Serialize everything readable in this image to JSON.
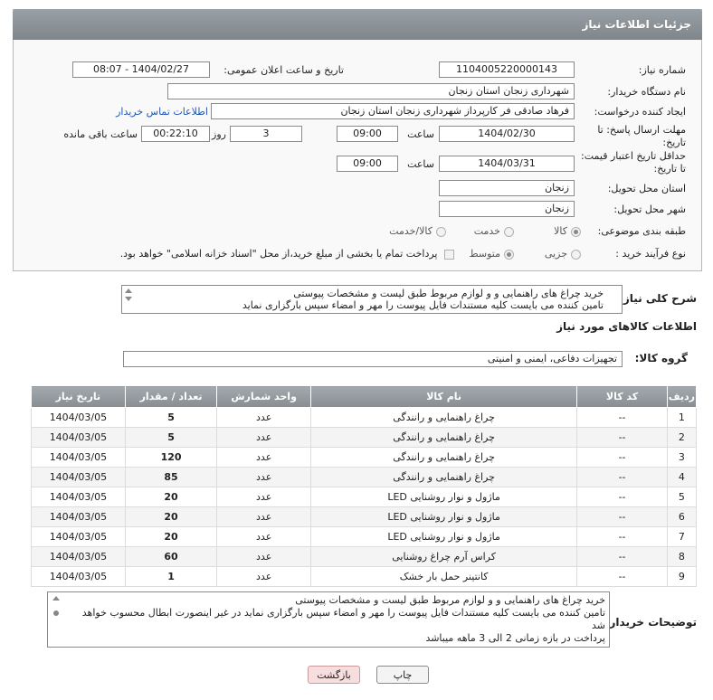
{
  "header": {
    "title": "جزئیات اطلاعات نیاز"
  },
  "form": {
    "need_number_label": "شماره نیاز:",
    "need_number": "1104005220000143",
    "announce_label": "تاریخ و ساعت اعلان عمومی:",
    "announce_value": "1404/02/27 - 08:07",
    "buyer_org_label": "نام دستگاه خریدار:",
    "buyer_org": "شهرداری زنجان استان زنجان",
    "creator_label": "ایجاد کننده درخواست:",
    "creator": "فرهاد صادقی فر کارپرداز شهرداری زنجان استان زنجان",
    "contact_link": "اطلاعات تماس خریدار",
    "deadline_label": "مهلت ارسال پاسخ: تا تاریخ:",
    "deadline_date": "1404/02/30",
    "time_label": "ساعت",
    "deadline_time": "09:00",
    "days_value": "3",
    "days_label": "روز و",
    "remaining_time": "00:22:10",
    "remaining_label": "ساعت باقی مانده",
    "price_valid_label": "حداقل تاریخ اعتبار قیمت: تا تاریخ:",
    "price_valid_date": "1404/03/31",
    "price_valid_time": "09:00",
    "province_label": "استان محل تحویل:",
    "province": "زنجان",
    "city_label": "شهر محل تحویل:",
    "city": "زنجان",
    "category_label": "طبقه بندی موضوعی:",
    "category_options": [
      "کالا",
      "خدمت",
      "کالا/خدمت"
    ],
    "purchase_type_label": "نوع فرآیند خرید :",
    "purchase_options": [
      "جزیی",
      "متوسط"
    ],
    "payment_note": "پرداخت تمام یا بخشی از مبلغ خرید،از محل \"اسناد خزانه اسلامی\" خواهد بود."
  },
  "description": {
    "label": "شرح کلی نیاز:",
    "line1": "خرید چراغ های راهنمایی و و لوازم مربوط طبق لیست و مشخصات پیوستی",
    "line2": "تامین کننده می بایست کلیه مستندات فایل پیوست را مهر و امضاء سپس بارگزاری نماید"
  },
  "goods": {
    "section_title": "اطلاعات کالاهای مورد نیاز",
    "group_label": "گروه کالا:",
    "group_value": "تجهیزات دفاعی، ایمنی و امنیتی",
    "columns": [
      "ردیف",
      "کد کالا",
      "نام کالا",
      "واحد شمارش",
      "تعداد / مقدار",
      "تاریخ نیاز"
    ],
    "rows": [
      [
        "1",
        "--",
        "چراغ راهنمایی و رانندگی",
        "عدد",
        "5",
        "1404/03/05"
      ],
      [
        "2",
        "--",
        "چراغ راهنمایی و رانندگی",
        "عدد",
        "5",
        "1404/03/05"
      ],
      [
        "3",
        "--",
        "چراغ راهنمایی و رانندگی",
        "عدد",
        "120",
        "1404/03/05"
      ],
      [
        "4",
        "--",
        "چراغ راهنمایی و رانندگی",
        "عدد",
        "85",
        "1404/03/05"
      ],
      [
        "5",
        "--",
        "ماژول و نوار روشنایی LED",
        "عدد",
        "20",
        "1404/03/05"
      ],
      [
        "6",
        "--",
        "ماژول و نوار روشنایی LED",
        "عدد",
        "20",
        "1404/03/05"
      ],
      [
        "7",
        "--",
        "ماژول و نوار روشنایی LED",
        "عدد",
        "20",
        "1404/03/05"
      ],
      [
        "8",
        "--",
        "کراس آرم چراغ روشنایی",
        "عدد",
        "60",
        "1404/03/05"
      ],
      [
        "9",
        "--",
        "کانتینر حمل بار خشک",
        "عدد",
        "1",
        "1404/03/05"
      ]
    ]
  },
  "buyer_notes": {
    "label": "توضیحات خریدار:",
    "line1": "خرید چراغ های راهنمایی و و لوازم مربوط طبق لیست و مشخصات پیوستی",
    "line2": "تامین کننده می بایست کلیه مستندات فایل پیوست را مهر و امضاء سپس بارگزاری نماید در غیر اینصورت ابطال محسوب خواهد شد",
    "line3": "پرداخت در بازه زمانی 2 الی 3 ماهه میباشد"
  },
  "buttons": {
    "print": "چاپ",
    "back": "بازگشت"
  }
}
